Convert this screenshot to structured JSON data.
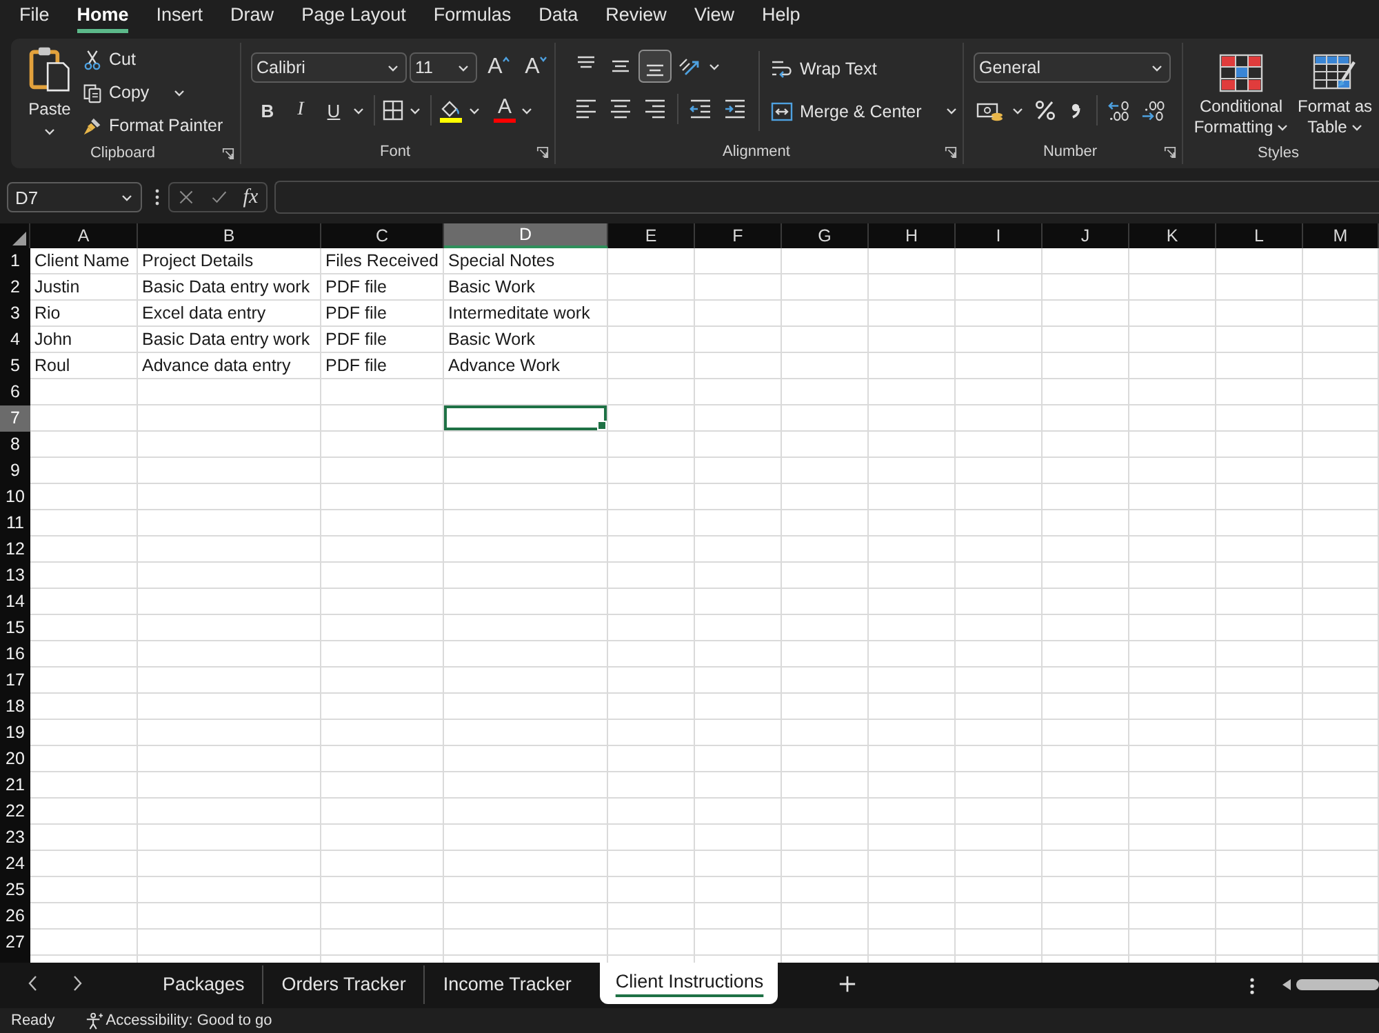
{
  "menu_tabs": [
    {
      "label": "File",
      "selected": false
    },
    {
      "label": "Home",
      "selected": true
    },
    {
      "label": "Insert",
      "selected": false
    },
    {
      "label": "Draw",
      "selected": false
    },
    {
      "label": "Page Layout",
      "selected": false
    },
    {
      "label": "Formulas",
      "selected": false
    },
    {
      "label": "Data",
      "selected": false
    },
    {
      "label": "Review",
      "selected": false
    },
    {
      "label": "View",
      "selected": false
    },
    {
      "label": "Help",
      "selected": false
    }
  ],
  "ribbon": {
    "clipboard": {
      "paste": "Paste",
      "cut": "Cut",
      "copy": "Copy",
      "format_painter": "Format Painter",
      "label": "Clipboard"
    },
    "font": {
      "font_name": "Calibri",
      "font_size": "11",
      "grow_font": "A",
      "shrink_font": "A",
      "styles": [
        {
          "kind": "bold",
          "label": "B"
        },
        {
          "kind": "italic",
          "label": "I"
        },
        {
          "kind": "underline",
          "label": "U"
        }
      ],
      "font_color": "A",
      "label": "Font"
    },
    "alignment": {
      "vertical": [
        {
          "kind": "top",
          "selected": false
        },
        {
          "kind": "middle",
          "selected": false
        },
        {
          "kind": "bottom",
          "selected": true
        }
      ],
      "horizontal": [
        {
          "kind": "left",
          "selected": false
        },
        {
          "kind": "center",
          "selected": false
        },
        {
          "kind": "right",
          "selected": false
        }
      ],
      "wrap_text": "Wrap Text",
      "merge_center": "Merge & Center",
      "label": "Alignment"
    },
    "number": {
      "format": "General",
      "label": "Number"
    },
    "styles": {
      "conditional_formatting": "Conditional Formatting",
      "format_as_table": "Format as Table",
      "label": "Styles"
    }
  },
  "formula_bar": {
    "name_box": "D7",
    "function_symbol": "fx"
  },
  "sheet": {
    "columns": [
      {
        "label": "A",
        "selected": false
      },
      {
        "label": "B",
        "selected": false
      },
      {
        "label": "C",
        "selected": false
      },
      {
        "label": "D",
        "selected": true
      },
      {
        "label": "E",
        "selected": false
      },
      {
        "label": "F",
        "selected": false
      },
      {
        "label": "G",
        "selected": false
      },
      {
        "label": "H",
        "selected": false
      },
      {
        "label": "I",
        "selected": false
      },
      {
        "label": "J",
        "selected": false
      },
      {
        "label": "K",
        "selected": false
      },
      {
        "label": "L",
        "selected": false
      },
      {
        "label": "M",
        "selected": false
      }
    ],
    "rows": [
      {
        "label": "1",
        "selected": false,
        "cells": [
          "Client Name",
          "Project Details",
          "Files Received",
          "Special Notes"
        ]
      },
      {
        "label": "2",
        "selected": false,
        "cells": [
          "Justin",
          "Basic Data entry work",
          "PDF file",
          "Basic Work"
        ]
      },
      {
        "label": "3",
        "selected": false,
        "cells": [
          "Rio",
          "Excel data entry",
          "PDF file",
          "Intermeditate work"
        ]
      },
      {
        "label": "4",
        "selected": false,
        "cells": [
          "John",
          "Basic Data entry work",
          "PDF file",
          "Basic Work"
        ]
      },
      {
        "label": "5",
        "selected": false,
        "cells": [
          "Roul",
          "Advance data entry",
          "PDF file",
          "Advance Work"
        ]
      },
      {
        "label": "6",
        "selected": false
      },
      {
        "label": "7",
        "selected": true
      },
      {
        "label": "8",
        "selected": false
      },
      {
        "label": "9",
        "selected": false
      },
      {
        "label": "10",
        "selected": false
      },
      {
        "label": "11",
        "selected": false
      },
      {
        "label": "12",
        "selected": false
      },
      {
        "label": "13",
        "selected": false
      },
      {
        "label": "14",
        "selected": false
      },
      {
        "label": "15",
        "selected": false
      },
      {
        "label": "16",
        "selected": false
      },
      {
        "label": "17",
        "selected": false
      },
      {
        "label": "18",
        "selected": false
      },
      {
        "label": "19",
        "selected": false
      },
      {
        "label": "20",
        "selected": false
      },
      {
        "label": "21",
        "selected": false
      },
      {
        "label": "22",
        "selected": false
      },
      {
        "label": "23",
        "selected": false
      },
      {
        "label": "24",
        "selected": false
      },
      {
        "label": "25",
        "selected": false
      },
      {
        "label": "26",
        "selected": false
      },
      {
        "label": "27",
        "selected": false
      }
    ]
  },
  "sheet_tabs": [
    {
      "label": "Packages",
      "selected": false
    },
    {
      "label": "Orders Tracker",
      "selected": false
    },
    {
      "label": "Income Tracker",
      "selected": false
    },
    {
      "label": "Client Instructions",
      "selected": true
    }
  ],
  "status_bar": {
    "mode": "Ready",
    "accessibility": "Accessibility: Good to go"
  }
}
